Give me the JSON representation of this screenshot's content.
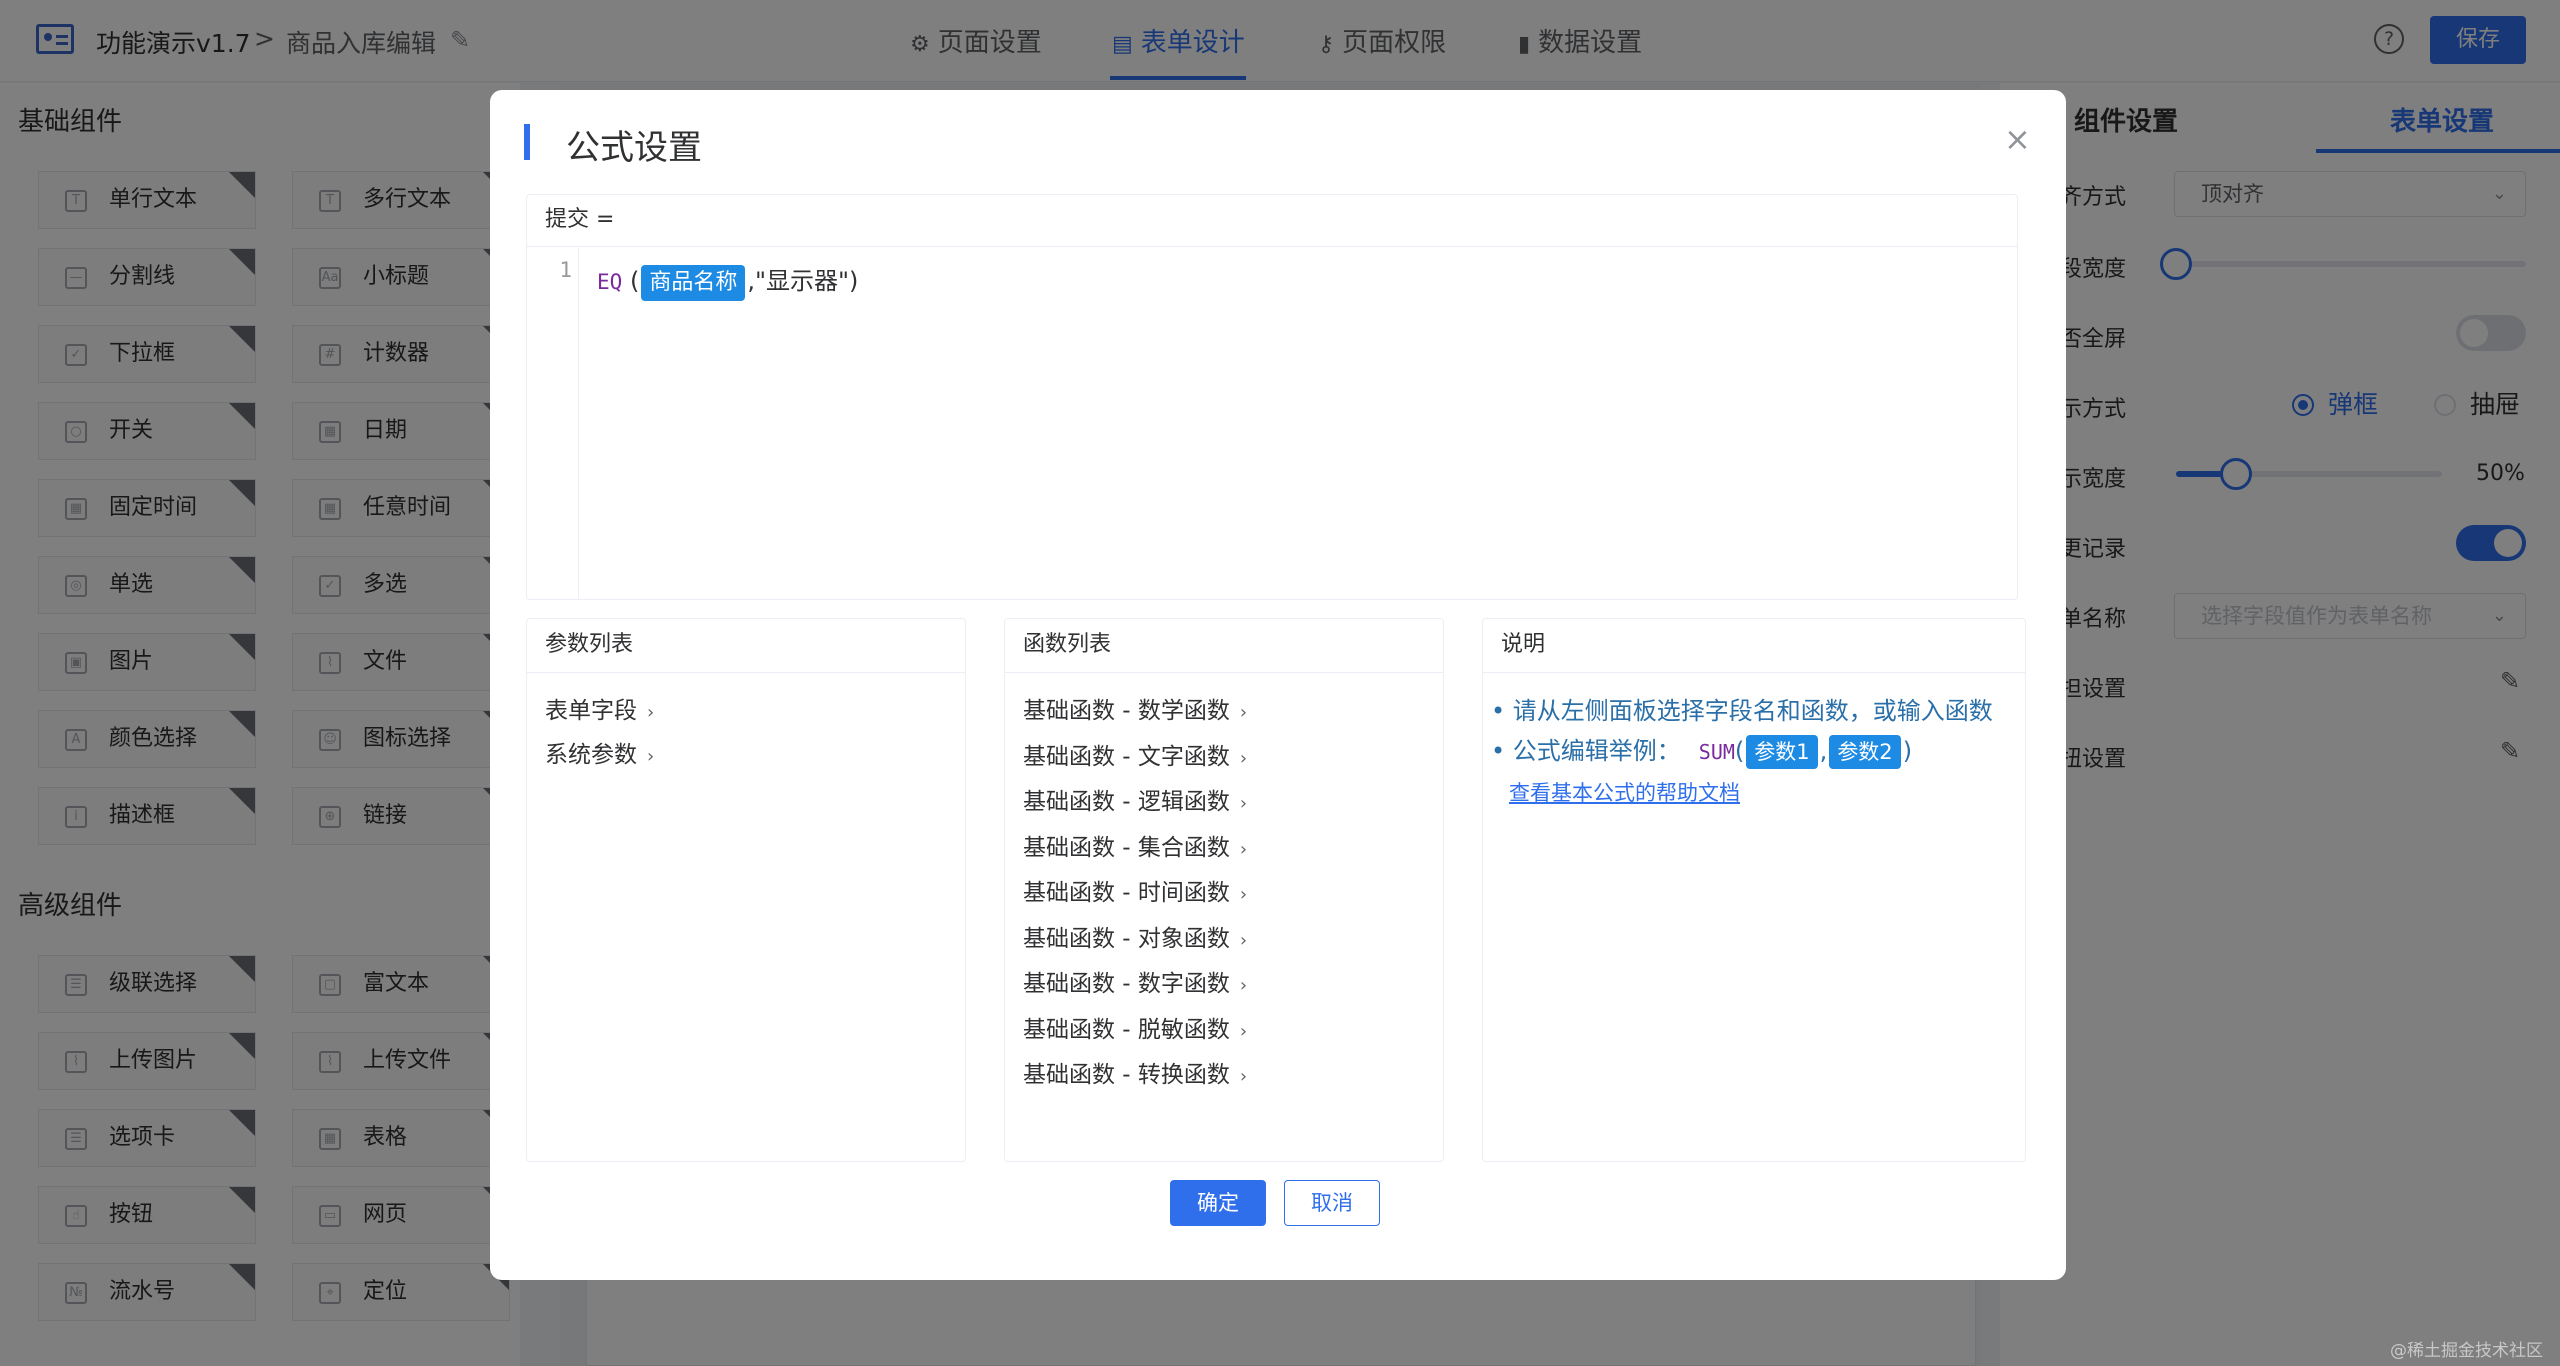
{
  "header": {
    "app_title": "功能演示v1.7",
    "separator": ">",
    "page_title": "商品入库编辑",
    "tabs": [
      {
        "label": "页面设置",
        "icon": "gear-icon"
      },
      {
        "label": "表单设计",
        "icon": "document-icon"
      },
      {
        "label": "页面权限",
        "icon": "key-icon"
      },
      {
        "label": "数据设置",
        "icon": "bar-chart-icon"
      }
    ],
    "active_tab": "表单设计",
    "help": "?",
    "save_label": "保存"
  },
  "left_panel": {
    "basic_title": "基础组件",
    "basic_items": [
      {
        "label": "单行文本",
        "icon": "T"
      },
      {
        "label": "多行文本",
        "icon": "T"
      },
      {
        "label": "分割线",
        "icon": "—"
      },
      {
        "label": "小标题",
        "icon": "Aa"
      },
      {
        "label": "下拉框",
        "icon": "✓"
      },
      {
        "label": "计数器",
        "icon": "#"
      },
      {
        "label": "开关",
        "icon": "○"
      },
      {
        "label": "日期",
        "icon": "▦"
      },
      {
        "label": "固定时间",
        "icon": "▦"
      },
      {
        "label": "任意时间",
        "icon": "▦"
      },
      {
        "label": "单选",
        "icon": "◎"
      },
      {
        "label": "多选",
        "icon": "✓"
      },
      {
        "label": "图片",
        "icon": "▣"
      },
      {
        "label": "文件",
        "icon": "⌇"
      },
      {
        "label": "颜色选择",
        "icon": "A"
      },
      {
        "label": "图标选择",
        "icon": "☺"
      },
      {
        "label": "描述框",
        "icon": "i"
      },
      {
        "label": "链接",
        "icon": "⊕"
      }
    ],
    "advanced_title": "高级组件",
    "advanced_items": [
      {
        "label": "级联选择",
        "icon": "☰"
      },
      {
        "label": "富文本",
        "icon": "▢"
      },
      {
        "label": "上传图片",
        "icon": "⌇"
      },
      {
        "label": "上传文件",
        "icon": "⌇"
      },
      {
        "label": "选项卡",
        "icon": "☰"
      },
      {
        "label": "表格",
        "icon": "▦"
      },
      {
        "label": "按钮",
        "icon": "☝"
      },
      {
        "label": "网页",
        "icon": "▭"
      },
      {
        "label": "流水号",
        "icon": "№"
      },
      {
        "label": "定位",
        "icon": "⌖"
      }
    ]
  },
  "right_panel": {
    "tabs": [
      "组件设置",
      "表单设置"
    ],
    "active_tab": "表单设置",
    "rows": {
      "align_label": "齐方式",
      "align_value": "顶对齐",
      "label_width_label": "段宽度",
      "fullscreen_label": "否全屏",
      "display_label": "示方式",
      "display_options": [
        "弹框",
        "抽屉"
      ],
      "display_selected": "弹框",
      "width_label": "示宽度",
      "width_value": "50%",
      "history_label": "更记录",
      "form_name_label": "单名称",
      "form_name_placeholder": "选择字段值作为表单名称",
      "rule_label": "担设置",
      "button_label": "扭设置"
    },
    "width_fraction": 0.5,
    "label_width_fraction": 0.0,
    "fullscreen_on": false,
    "history_on": true
  },
  "modal": {
    "title": "公式设置",
    "close": "×",
    "editor": {
      "header": "提交  =",
      "line_number": "1",
      "fn": "EQ",
      "open": "(",
      "field_tag": "商品名称",
      "rest": ",\"显示器\")"
    },
    "params": {
      "title": "参数列表",
      "items": [
        "表单字段",
        "系统参数"
      ]
    },
    "functions": {
      "title": "函数列表",
      "items": [
        "基础函数 - 数学函数",
        "基础函数 - 文字函数",
        "基础函数 - 逻辑函数",
        "基础函数 - 集合函数",
        "基础函数 - 时间函数",
        "基础函数 - 对象函数",
        "基础函数 - 数字函数",
        "基础函数 - 脱敏函数",
        "基础函数 - 转换函数"
      ]
    },
    "description": {
      "title": "说明",
      "line1": "请从左侧面板选择字段名和函数，或输入函数",
      "line2_label": "公式编辑举例：",
      "example_fn": "SUM",
      "example_open": "(",
      "param1": "参数1",
      "comma": ",",
      "param2": "参数2",
      "example_close": ")",
      "help_link": "查看基本公式的帮助文档"
    },
    "ok_label": "确定",
    "cancel_label": "取消"
  },
  "watermark": "@稀土掘金技术社区",
  "colors": {
    "primary": "#2f6fec",
    "tag": "#1d8ae3",
    "function": "#7a2a9e",
    "overlay": "rgba(0,0,0,0.5)"
  }
}
